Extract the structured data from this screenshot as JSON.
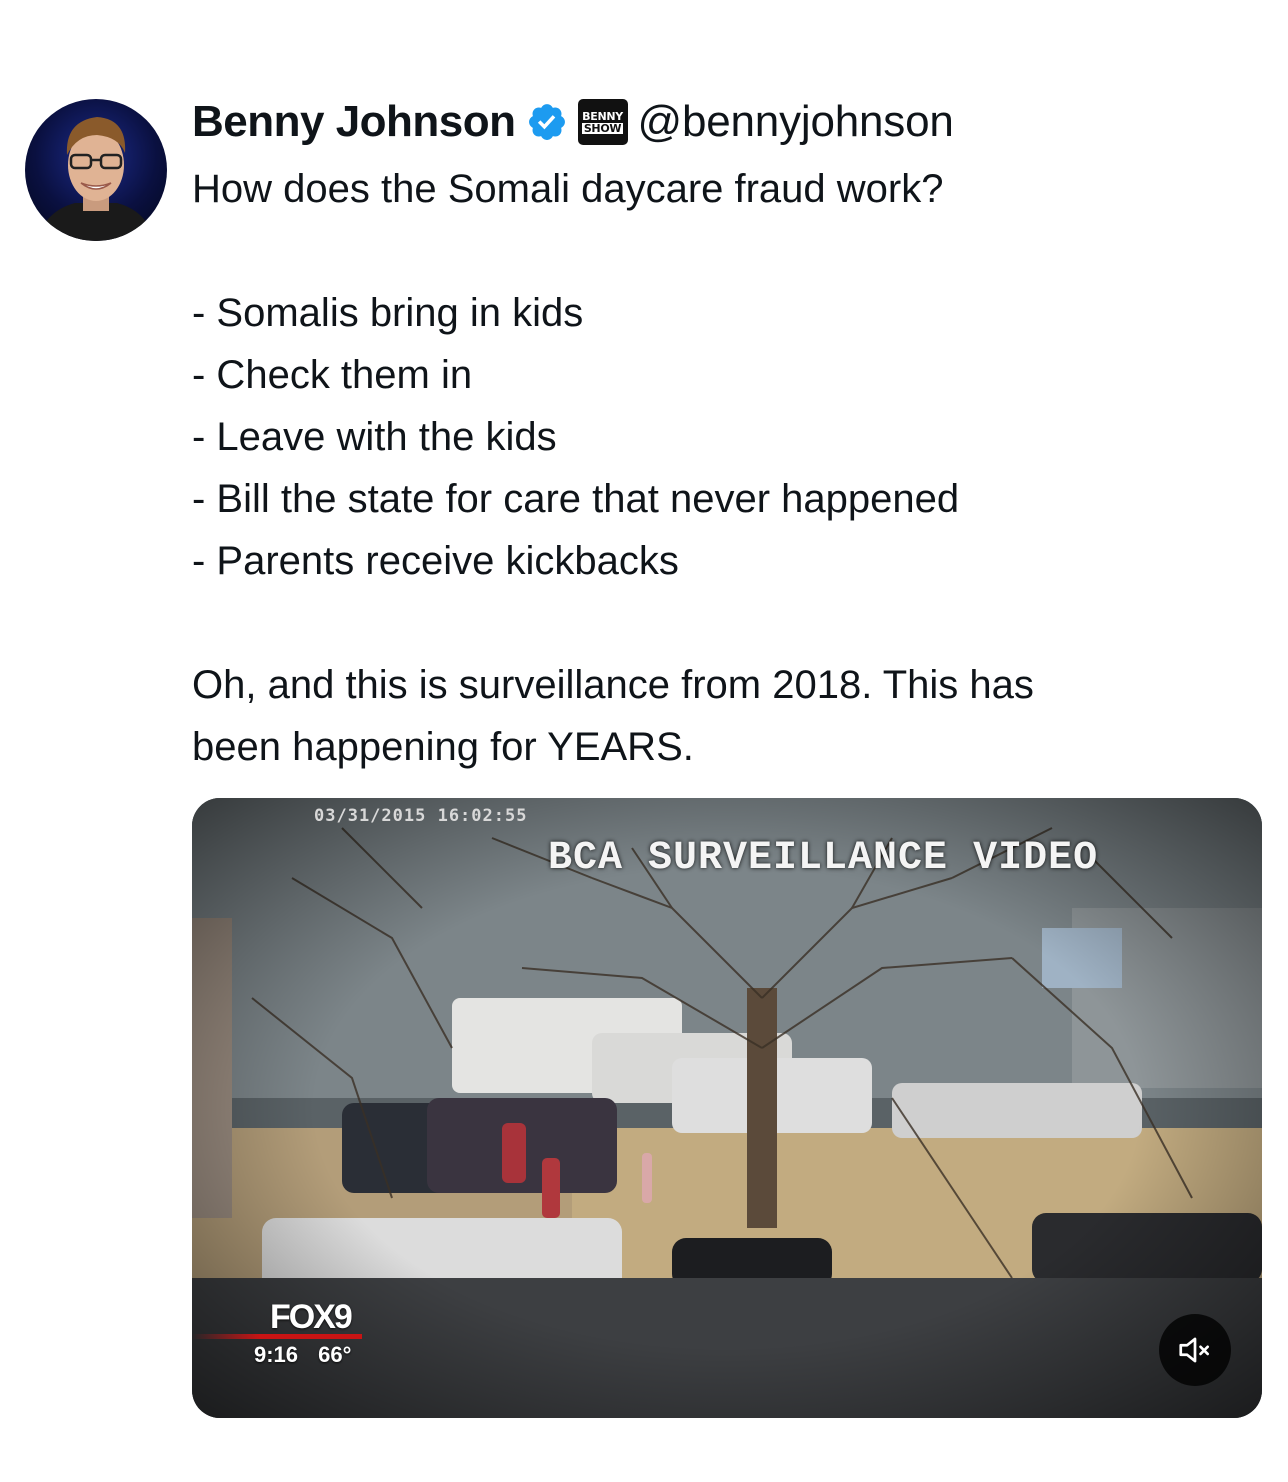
{
  "author": {
    "display_name": "Benny Johnson",
    "handle": "@bennyjohnson",
    "affiliation_badge": [
      "BENNY",
      "SHOW"
    ],
    "verified_color": "#1d9bf0"
  },
  "tweet": {
    "lines": [
      "How does the Somali daycare fraud work?",
      "",
      "- Somalis bring in kids",
      "- Check them in",
      "- Leave with the kids",
      "- Bill the state for care that never happened",
      "- Parents receive kickbacks",
      "",
      "Oh, and this is surveillance from 2018. This has",
      "been happening for YEARS."
    ]
  },
  "media": {
    "type": "video",
    "timestamp_overlay": "03/31/2015 16:02:55",
    "caption_overlay": "BCA SURVEILLANCE VIDEO",
    "station_logo": "FOX9",
    "station_info": "9:16 66°",
    "mute_icon": "speaker-muted-icon"
  }
}
